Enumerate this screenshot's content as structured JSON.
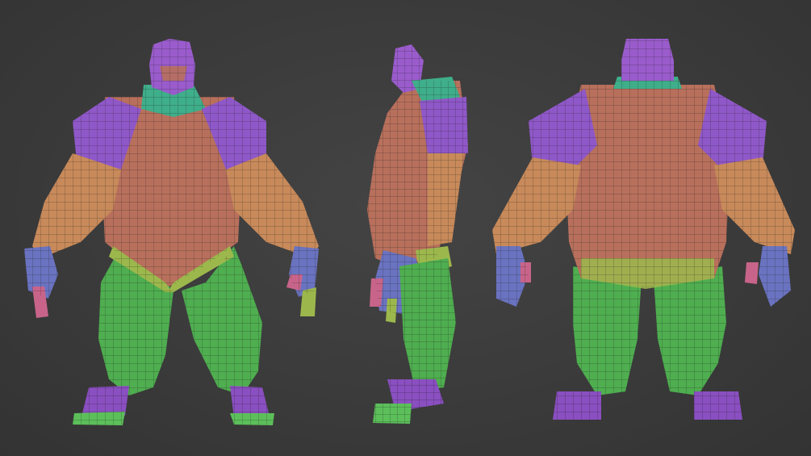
{
  "scene": {
    "background": "#3b3b3b",
    "views": [
      {
        "name": "front",
        "label": ""
      },
      {
        "name": "side",
        "label": ""
      },
      {
        "name": "back",
        "label": ""
      }
    ]
  },
  "polygroup_colors": {
    "head": "#9a5ccc",
    "neck": "#3fae8a",
    "shoulders": "#8f58c8",
    "torso": "#b8705c",
    "arms": "#c88a5a",
    "hands": "#6a73c0",
    "fingers_alt": "#c8648a",
    "legs": "#4fae50",
    "feet": "#8a4fc0",
    "toes": "#5cbf5a",
    "pelvis_trim": "#9cb84c"
  },
  "icons": {
    "front": "character-front-view-icon",
    "side": "character-side-view-icon",
    "back": "character-back-view-icon"
  }
}
